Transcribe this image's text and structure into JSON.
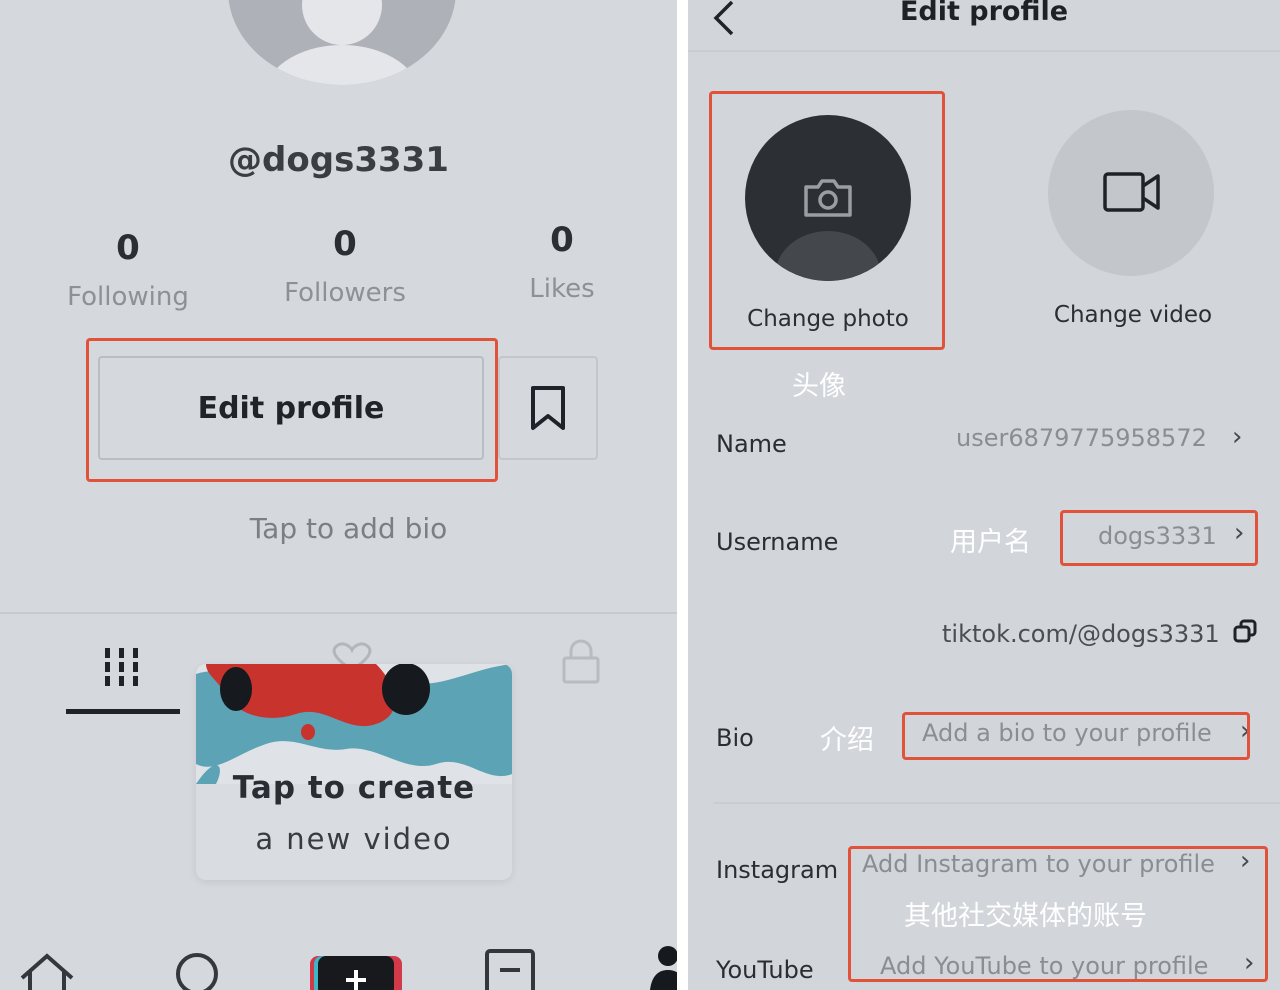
{
  "profile_screen": {
    "username": "@dogs3331",
    "stats": [
      {
        "value": "0",
        "label": "Following"
      },
      {
        "value": "0",
        "label": "Followers"
      },
      {
        "value": "0",
        "label": "Likes"
      }
    ],
    "edit_profile_label": "Edit profile",
    "bio_hint": "Tap to add bio",
    "create_card": {
      "line1": "Tap to create",
      "line2": "a new video"
    },
    "bottom_nav_icons": [
      "home-icon",
      "search-icon",
      "create-icon",
      "inbox-icon",
      "profile-icon"
    ]
  },
  "edit_screen": {
    "title": "Edit profile",
    "change_photo_label": "Change photo",
    "change_video_label": "Change video",
    "annotations": {
      "avatar": "头像",
      "username": "用户名",
      "bio": "介绍",
      "social": "其他社交媒体的账号"
    },
    "rows": {
      "name": {
        "label": "Name",
        "value": "user6879775958572"
      },
      "username": {
        "label": "Username",
        "value": "dogs3331"
      },
      "link": "tiktok.com/@dogs3331",
      "bio": {
        "label": "Bio",
        "placeholder": "Add a bio to your profile"
      },
      "instagram": {
        "label": "Instagram",
        "placeholder": "Add Instagram to your profile"
      },
      "youtube": {
        "label": "YouTube",
        "placeholder": "Add YouTube to your profile"
      }
    }
  },
  "colors": {
    "highlight": "#e0533a",
    "background": "#d5d8dd",
    "text_dark": "#1f2329",
    "text_muted": "#8a8d93"
  }
}
